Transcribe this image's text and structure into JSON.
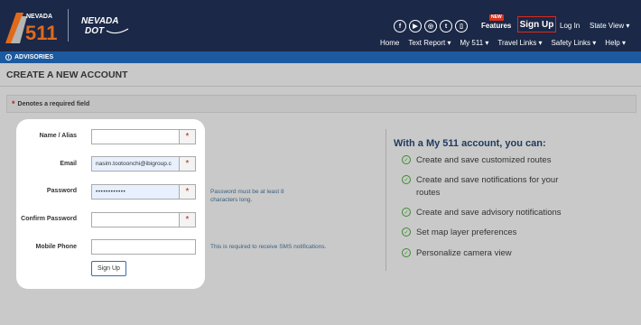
{
  "header": {
    "logo_511_text": "NEVADA 511",
    "logo_ndot_text": "NEVADA DOT",
    "social_icons": [
      "facebook-icon",
      "youtube-icon",
      "instagram-icon",
      "twitter-icon",
      "mobile-icon"
    ],
    "new_badge": "NEW",
    "features_label": "Features",
    "signup_label": "Sign Up",
    "login_label": "Log In",
    "state_view_label": "State View ▾",
    "nav": [
      "Home",
      "Text Report ▾",
      "My 511 ▾",
      "Travel Links ▾",
      "Safety Links ▾",
      "Help ▾"
    ],
    "colors": {
      "header_bg": "#1b2847",
      "accent_red": "#d92b1e",
      "advisory_bar": "#1c5aa0"
    }
  },
  "advisories": {
    "label": "ADVISORIES",
    "icon": "info-icon"
  },
  "page_title": "CREATE A NEW ACCOUNT",
  "required_note": {
    "star": "*",
    "text": "Denotes a required field"
  },
  "form": {
    "name_label": "Name / Alias",
    "name_value": "",
    "email_label": "Email",
    "email_value": "nasim.tootoonchi@ibigroup.c",
    "password_label": "Password",
    "password_value": "••••••••••••",
    "confirm_label": "Confirm Password",
    "confirm_value": "",
    "phone_label": "Mobile Phone",
    "phone_value": "",
    "required_mark": "*",
    "submit_label": "Sign Up"
  },
  "hints": {
    "password": "Password must be at least 8 characters long.",
    "phone": "This is required to receive SMS notifications."
  },
  "benefits": {
    "title": "With a My 511 account, you can:",
    "items": [
      "Create and save customized routes",
      "Create and save notifications for your routes",
      "Create and save advisory notifications",
      "Set map layer preferences",
      "Personalize camera view"
    ]
  }
}
